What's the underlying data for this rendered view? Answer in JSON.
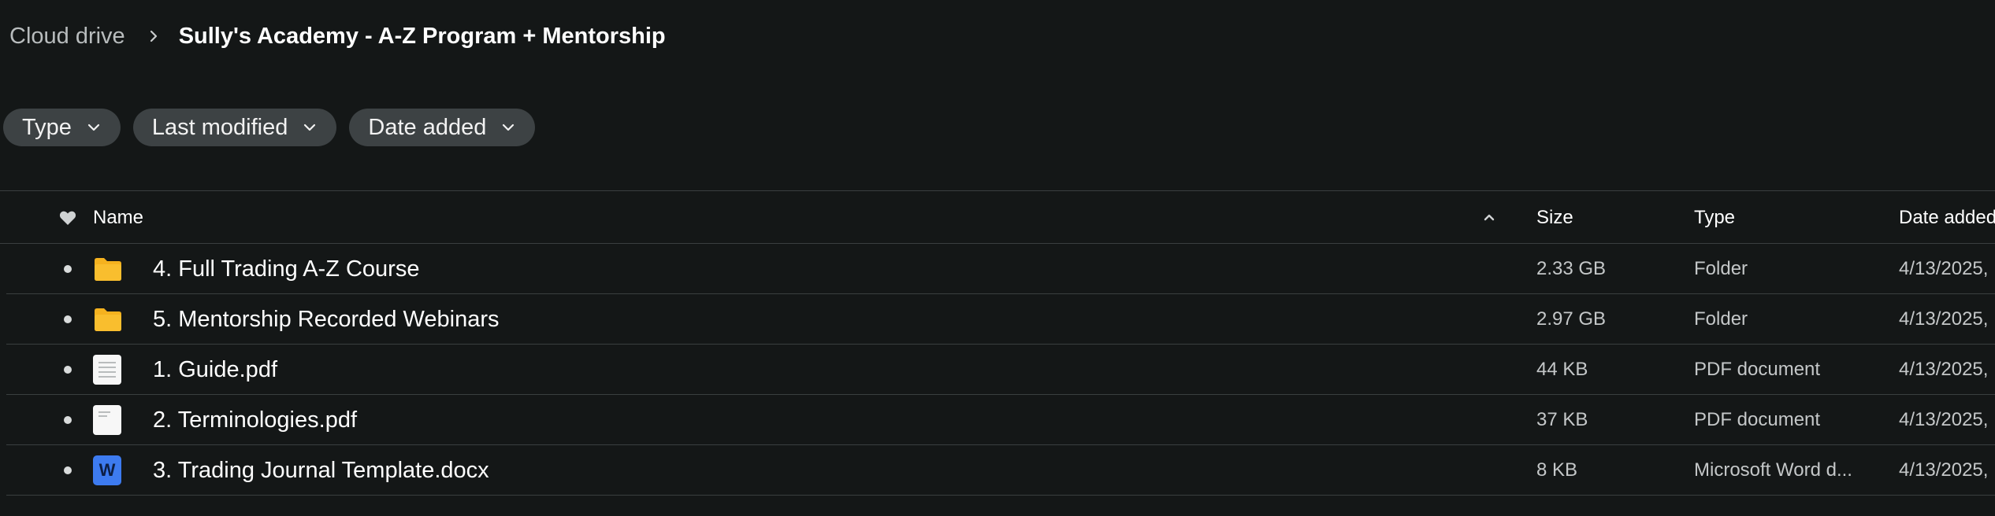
{
  "breadcrumb": {
    "root": "Cloud drive",
    "current": "Sully's Academy - A-Z Program + Mentorship"
  },
  "filters": [
    {
      "label": "Type"
    },
    {
      "label": "Last modified"
    },
    {
      "label": "Date added"
    }
  ],
  "table": {
    "headers": {
      "favorite_icon": "heart-icon",
      "name": "Name",
      "size": "Size",
      "type": "Type",
      "date": "Date added"
    },
    "sort": {
      "column": "Name",
      "direction": "ascending"
    },
    "rows": [
      {
        "icon": "folder-icon",
        "name": "4. Full Trading A-Z Course",
        "size": "2.33 GB",
        "type": "Folder",
        "date": "4/13/2025,"
      },
      {
        "icon": "folder-icon",
        "name": "5. Mentorship Recorded Webinars",
        "size": "2.97 GB",
        "type": "Folder",
        "date": "4/13/2025,"
      },
      {
        "icon": "pdf-document-icon",
        "name": "1. Guide.pdf",
        "size": "44 KB",
        "type": "PDF document",
        "date": "4/13/2025,"
      },
      {
        "icon": "pdf-document-icon",
        "name": "2. Terminologies.pdf",
        "size": "37 KB",
        "type": "PDF document",
        "date": "4/13/2025,"
      },
      {
        "icon": "word-document-icon",
        "name": "3. Trading Journal Template.docx",
        "size": "8 KB",
        "type": "Microsoft Word d...",
        "date": "4/13/2025,"
      }
    ]
  },
  "colors": {
    "background": "#141717",
    "chip": "#3d4244",
    "folder": "#f5b21f",
    "word": "#3d7bf0"
  }
}
